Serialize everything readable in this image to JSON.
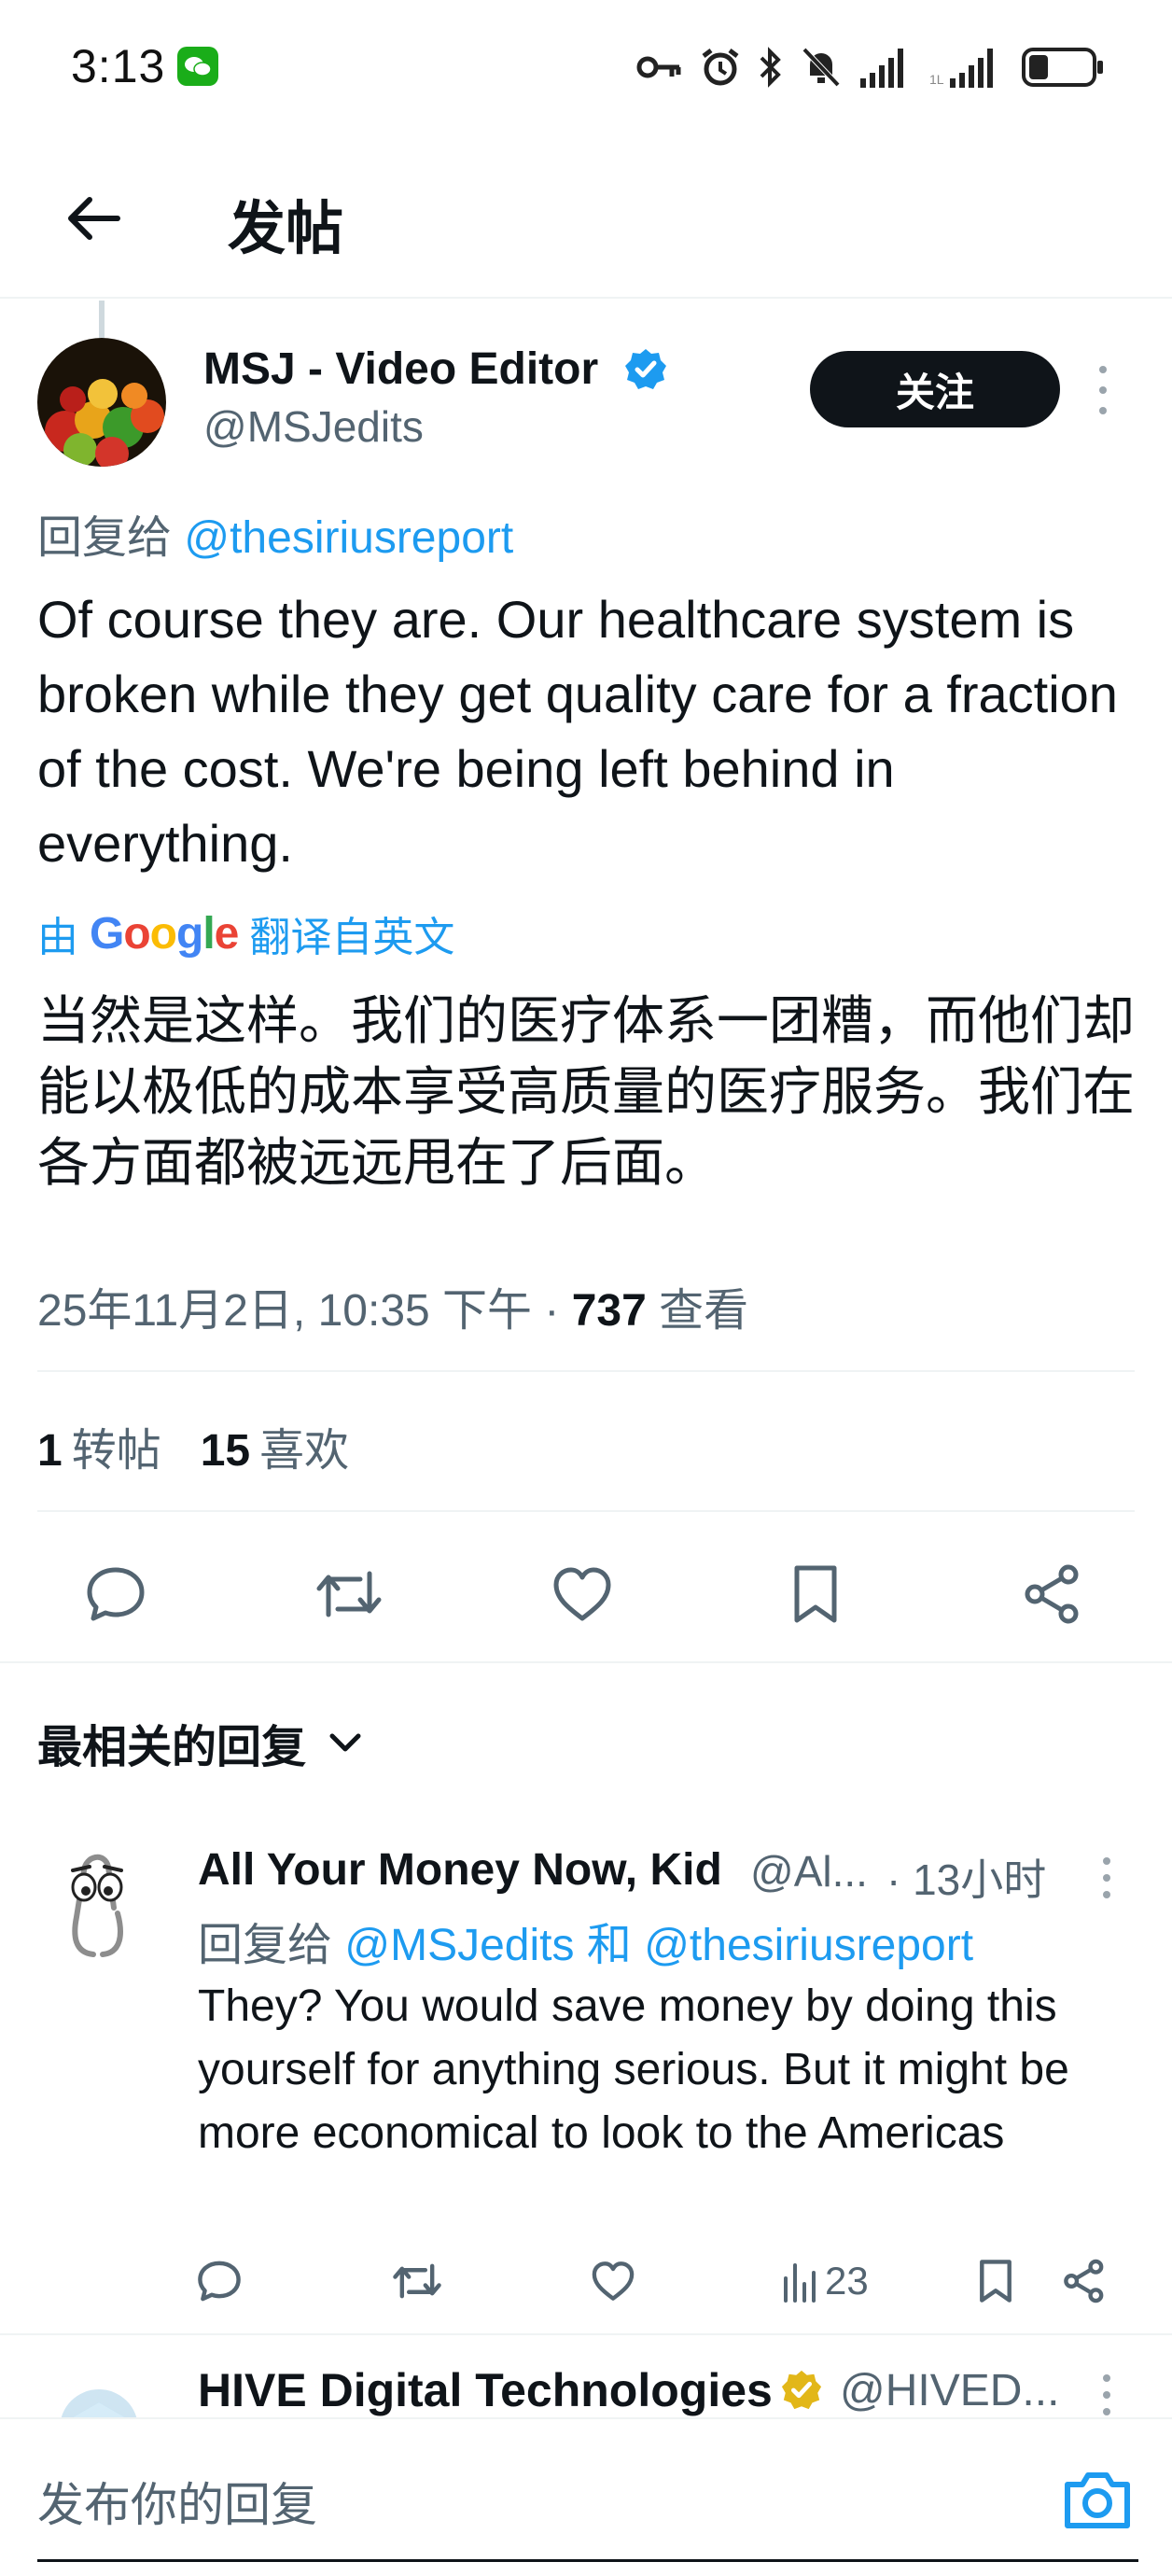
{
  "status_bar": {
    "time": "3:13",
    "icons": [
      "wechat-icon",
      "key-icon",
      "alarm-icon",
      "bluetooth-icon",
      "mute-icon",
      "signal-icon",
      "signal-icon-2",
      "battery-icon"
    ]
  },
  "header": {
    "title": "发帖"
  },
  "tweet": {
    "author_name": "MSJ - Video Editor",
    "author_handle": "@MSJedits",
    "follow_label": "关注",
    "reply_to_prefix": "回复给",
    "reply_to_mention": "@thesiriusreport",
    "text": "Of course they are. Our healthcare system is broken while they get quality care for a fraction of the cost. We're being left behind in everything.",
    "translate_prefix": "由",
    "translate_brand": "Google",
    "translate_suffix": "翻译自英文",
    "translated_text": "当然是这样。我们的医疗体系一团糟，而他们却能以极低的成本享受高质量的医疗服务。我们在各方面都被远远甩在了后面。",
    "timestamp": "25年11月2日, 10:35 下午 · ",
    "views_count": "737",
    "views_label": " 查看",
    "retweets_count": "1",
    "retweets_label": "转帖",
    "likes_count": "15",
    "likes_label": "喜欢"
  },
  "sort": {
    "label": "最相关的回复"
  },
  "replies": [
    {
      "name": "All Your Money Now, Kid",
      "handle": "@Al...",
      "time": "· 13小时",
      "reply_to_prefix": "回复给",
      "mention_1": "@MSJedits",
      "joiner": "和",
      "mention_2": "@thesiriusreport",
      "text": "They?  You would save money by doing this yourself for anything serious.  But it might be more economical to look to the Americas",
      "views": "23"
    },
    {
      "name": "HIVE Digital Technologies",
      "handle": "@HIVED..."
    }
  ],
  "compose": {
    "placeholder": "发布你的回复"
  },
  "colors": {
    "accent": "#1d9bf0",
    "text": "#0f1419",
    "muted": "#536471",
    "gold": "#e2b719"
  }
}
